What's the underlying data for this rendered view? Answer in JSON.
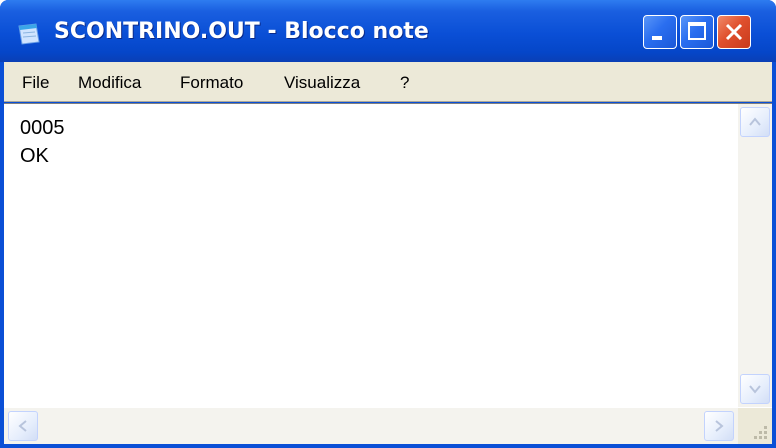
{
  "window": {
    "title": "SCONTRINO.OUT - Blocco note",
    "accent_color": "#0a4fd6",
    "close_color": "#e0502e"
  },
  "title_buttons": {
    "minimize_icon": "minimize-icon",
    "maximize_icon": "maximize-icon",
    "close_icon": "close-icon"
  },
  "menu": {
    "items": [
      "File",
      "Modifica",
      "Formato",
      "Visualizza",
      "?"
    ]
  },
  "document": {
    "lines": [
      "0005",
      "OK"
    ]
  }
}
